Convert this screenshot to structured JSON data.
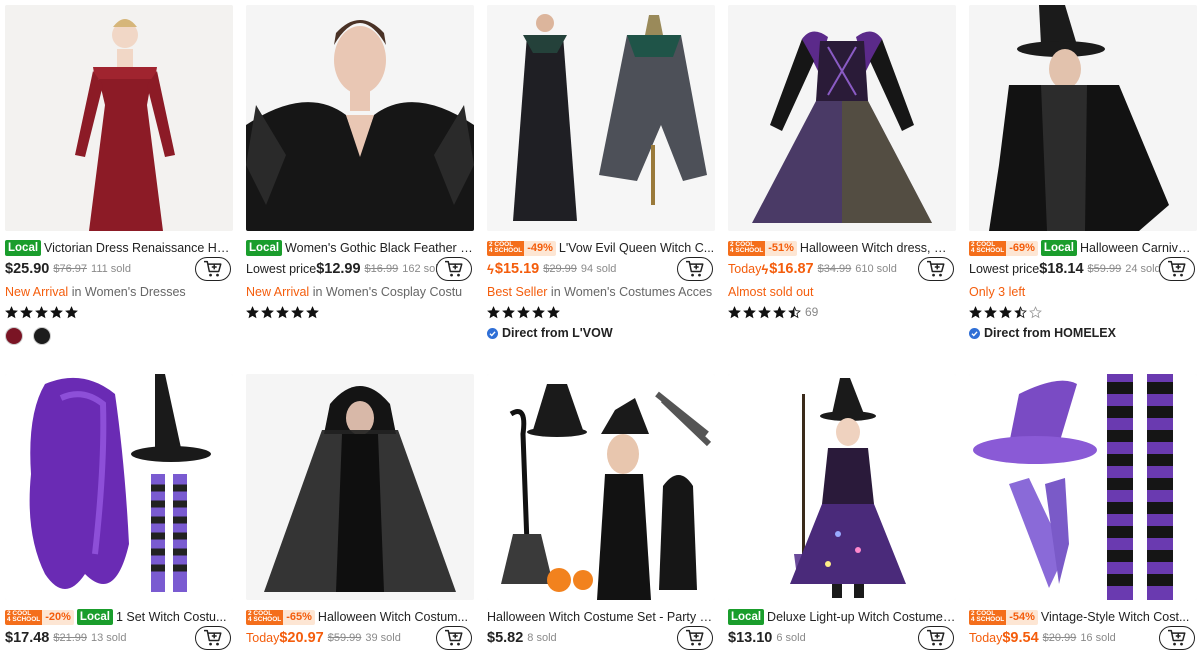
{
  "products": [
    {
      "title": "Victorian Dress Renaissance Hall...",
      "local": "Local",
      "cool": null,
      "prefix": "",
      "flash": false,
      "price": "$25.90",
      "orig": "$76.97",
      "sold": "111 sold",
      "tag_hl": "New Arrival",
      "tag_rest": " in Women's Dresses",
      "tag_color": "orange",
      "stars": 5,
      "reviews": "",
      "seller": "",
      "swatches": [
        "#7a1424",
        "#1c1c1c"
      ],
      "cart_icon": "add-to-cart-icon"
    },
    {
      "title": "Women's Gothic Black Feather S...",
      "local": "Local",
      "cool": null,
      "prefix": "Lowest price",
      "flash": false,
      "price": "$12.99",
      "orig": "$16.99",
      "sold": "162 sold",
      "tag_hl": "New Arrival",
      "tag_rest": " in Women's Cosplay Costu",
      "tag_color": "orange",
      "stars": 5,
      "reviews": "",
      "seller": "",
      "swatches": [],
      "cart_icon": "add-to-cart-icon"
    },
    {
      "title": "L'Vow Evil Queen Witch C...",
      "local": "",
      "cool": {
        "line1": "2 COOL",
        "line2": "4 SCHOOL",
        "pct": "-49%"
      },
      "prefix": "",
      "flash": true,
      "price": "$15.19",
      "orig": "$29.99",
      "sold": "94 sold",
      "tag_hl": "Best Seller",
      "tag_rest": " in Women's Costumes Acces",
      "tag_color": "orange",
      "stars": 5,
      "reviews": "",
      "seller": "Direct from L'VOW",
      "swatches": [],
      "cart_icon": "add-to-cart-icon"
    },
    {
      "title": "Halloween Witch dress, Gi...",
      "local": "",
      "cool": {
        "line1": "2 COOL",
        "line2": "4 SCHOOL",
        "pct": "-51%"
      },
      "prefix": "Today",
      "flash": true,
      "price": "$16.87",
      "orig": "$34.99",
      "sold": "610 sold",
      "tag_hl": "Almost sold out",
      "tag_rest": "",
      "tag_color": "orange",
      "stars": 4.5,
      "reviews": "69",
      "seller": "",
      "swatches": [],
      "cart_icon": "add-to-cart-icon"
    },
    {
      "title": "Halloween Carnival...",
      "local": "Local",
      "cool": {
        "line1": "2 COOL",
        "line2": "4 SCHOOL",
        "pct": "-69%"
      },
      "prefix": "Lowest price",
      "flash": false,
      "price": "$18.14",
      "orig": "$59.99",
      "sold": "24 sold",
      "tag_hl": "Only 3 left",
      "tag_rest": "",
      "tag_color": "orange",
      "stars": 3.5,
      "reviews": "",
      "seller": "Direct from HOMELEX",
      "swatches": [],
      "cart_icon": "add-to-cart-icon"
    },
    {
      "title": "1 Set Witch Costu...",
      "local": "Local",
      "cool": {
        "line1": "2 COOL",
        "line2": "4 SCHOOL",
        "pct": "-20%"
      },
      "prefix": "",
      "flash": false,
      "price": "$17.48",
      "orig": "$21.99",
      "sold": "13 sold",
      "tag_hl": "",
      "tag_rest": "",
      "tag_color": "orange",
      "stars": 0,
      "reviews": "",
      "seller": "",
      "swatches": [],
      "cart_icon": "add-to-cart-icon"
    },
    {
      "title": "Halloween Witch Costum...",
      "local": "",
      "cool": {
        "line1": "2 COOL",
        "line2": "4 SCHOOL",
        "pct": "-65%"
      },
      "prefix": "Today",
      "flash": false,
      "price": "$20.97",
      "orig": "$59.99",
      "sold": "39 sold",
      "tag_hl": "",
      "tag_rest": "",
      "tag_color": "orange",
      "stars": 0,
      "reviews": "",
      "seller": "",
      "swatches": [],
      "cart_icon": "add-to-cart-icon"
    },
    {
      "title": "Halloween Witch Costume Set - Party S...",
      "local": "",
      "cool": null,
      "prefix": "",
      "flash": false,
      "price": "$5.82",
      "orig": "",
      "sold": "8 sold",
      "tag_hl": "",
      "tag_rest": "",
      "tag_color": "orange",
      "stars": 0,
      "reviews": "",
      "seller": "",
      "swatches": [],
      "cart_icon": "add-to-cart-icon"
    },
    {
      "title": "Deluxe Light-up Witch Costume ...",
      "local": "Local",
      "cool": null,
      "prefix": "",
      "flash": false,
      "price": "$13.10",
      "orig": "",
      "sold": "6 sold",
      "tag_hl": "",
      "tag_rest": "",
      "tag_color": "orange",
      "stars": 0,
      "reviews": "",
      "seller": "",
      "swatches": [],
      "cart_icon": "add-to-cart-icon"
    },
    {
      "title": "Vintage-Style Witch Cost...",
      "local": "",
      "cool": {
        "line1": "2 COOL",
        "line2": "4 SCHOOL",
        "pct": "-54%"
      },
      "prefix": "Today",
      "flash": false,
      "price": "$9.54",
      "orig": "$20.99",
      "sold": "16 sold",
      "tag_hl": "",
      "tag_rest": "",
      "tag_color": "orange",
      "stars": 0,
      "reviews": "",
      "seller": "",
      "swatches": [],
      "cart_icon": "add-to-cart-icon"
    }
  ]
}
